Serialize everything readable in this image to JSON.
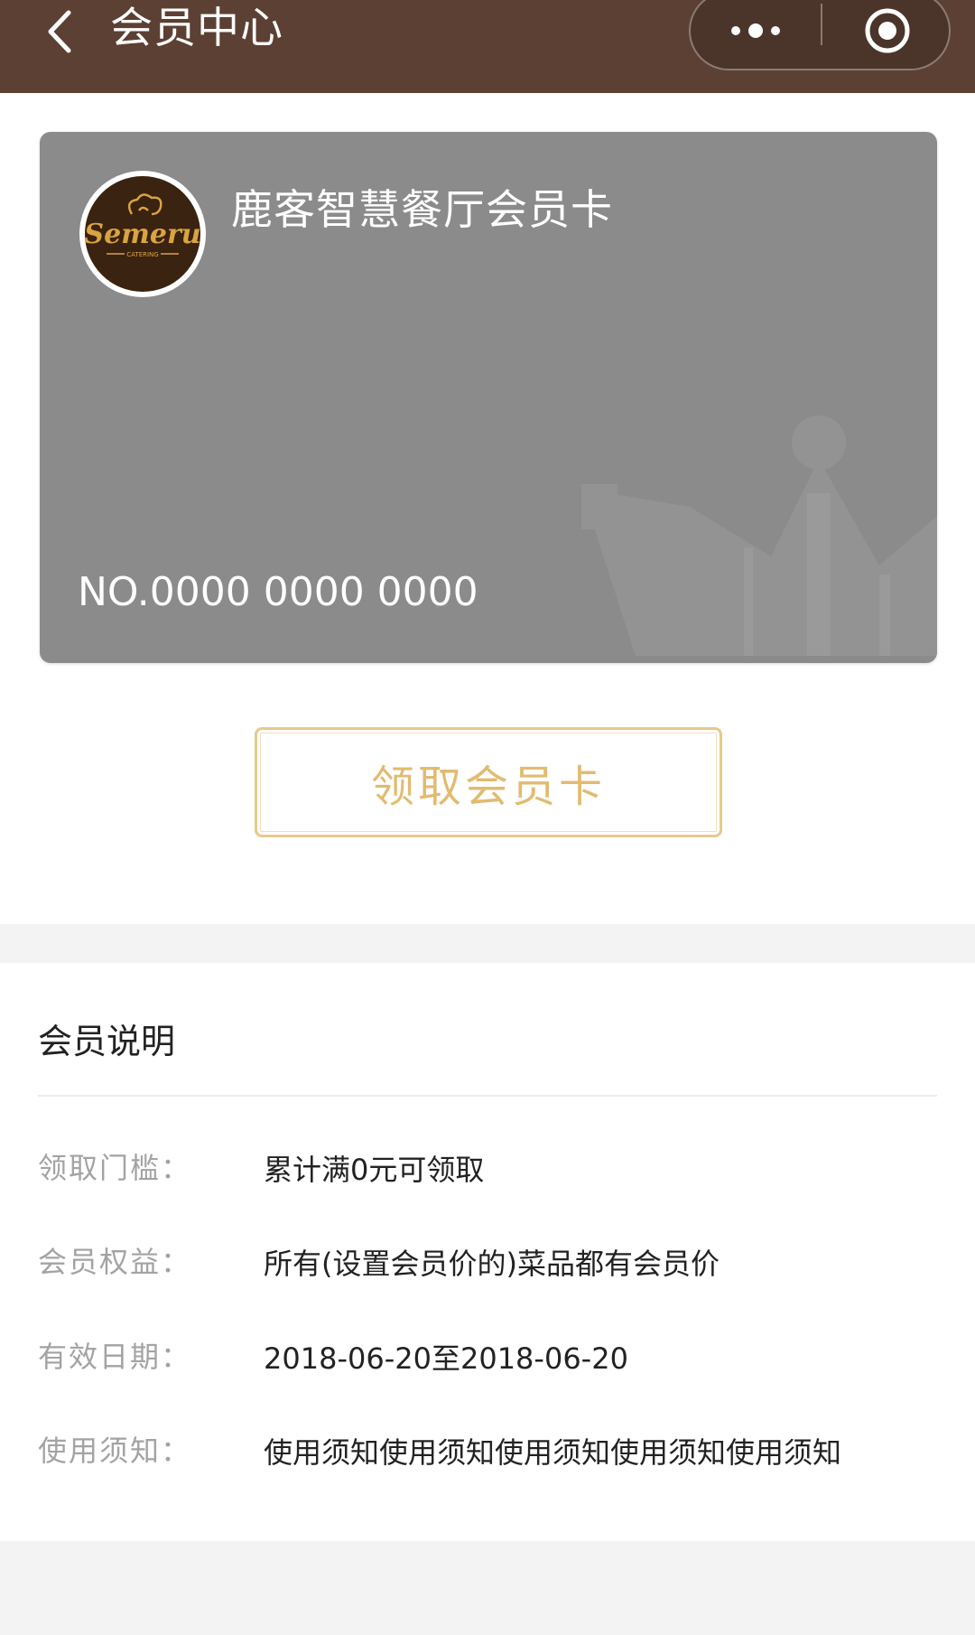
{
  "header": {
    "title": "会员中心",
    "bg_color": "#5c4033",
    "back_icon": "chevron-left-icon",
    "more_icon": "more-dots-icon",
    "close_icon": "target-circle-icon"
  },
  "card": {
    "name": "鹿客智慧餐厅会员卡",
    "number": "NO.0000 0000 0000",
    "logo_text": "Semeru",
    "logo_subtext": "CATERING",
    "bg_color": "#8b8b8b"
  },
  "claim_button": {
    "label": "领取会员卡",
    "color": "#e1bb70"
  },
  "info": {
    "title": "会员说明",
    "rows": [
      {
        "label": "领取门槛：",
        "value": "累计满0元可领取"
      },
      {
        "label": "会员权益：",
        "value": "所有(设置会员价的)菜品都有会员价"
      },
      {
        "label": "有效日期：",
        "value": "2018-06-20至2018-06-20"
      },
      {
        "label": "使用须知：",
        "value": "使用须知使用须知使用须知使用须知使用须知"
      }
    ]
  }
}
